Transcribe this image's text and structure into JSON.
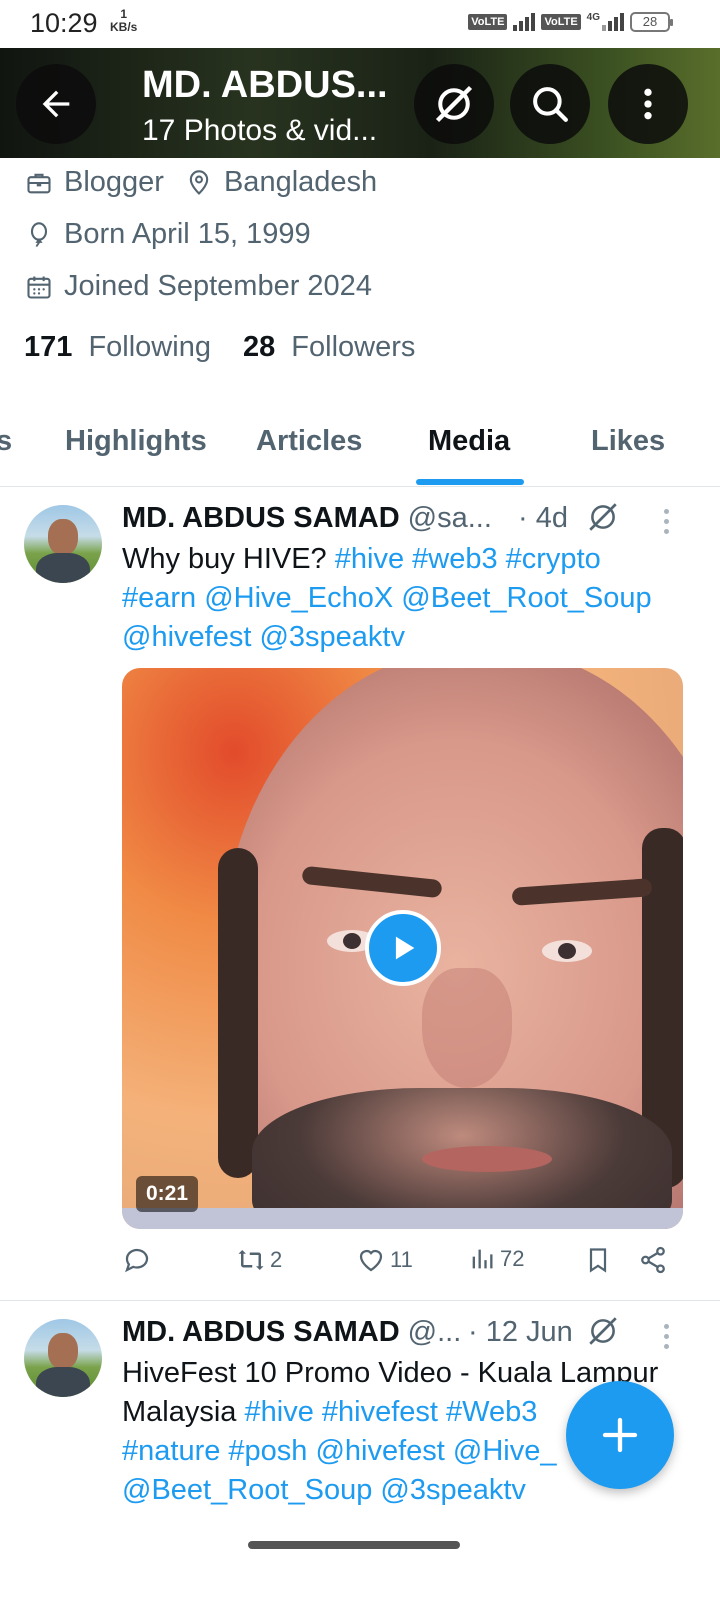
{
  "status_bar": {
    "time": "10:29",
    "net_speed_value": "1",
    "net_speed_unit": "KB/s",
    "volte_1": "VoLTE",
    "volte_2": "VoLTE",
    "network": "4G",
    "battery": "28"
  },
  "header": {
    "title": "MD. ABDUS...",
    "subtitle": "17 Photos & vid..."
  },
  "profile": {
    "category": "Blogger",
    "location": "Bangladesh",
    "born": "Born April 15, 1999",
    "joined": "Joined September 2024",
    "following_count": "171",
    "following_label": "Following",
    "followers_count": "28",
    "followers_label": "Followers"
  },
  "tabs": [
    {
      "label": "s"
    },
    {
      "label": "Highlights"
    },
    {
      "label": "Articles"
    },
    {
      "label": "Media",
      "active": true
    },
    {
      "label": "Likes"
    }
  ],
  "posts": [
    {
      "name": "MD. ABDUS SAMAD",
      "handle": "@sa...",
      "date": "· 4d",
      "text_plain": "Why buy HIVE? ",
      "line1_tags": "#hive #web3 #crypto",
      "line2_tags": "#earn @Hive_EchoX @Beet_Root_Soup",
      "line3_tags": "@hivefest @3speaktv",
      "video_duration": "0:21",
      "retweets": "2",
      "likes": "11",
      "views": "72"
    },
    {
      "name": "MD. ABDUS SAMAD",
      "handle": "@...",
      "date": "· 12 Jun",
      "line1_plain": "HiveFest 10 Promo Video - Kuala Lampur",
      "line2_plain": "Malaysia ",
      "line2_tags": "#hive #hivefest #Web3",
      "line3_tags": "#nature #posh @hivefest @Hive_",
      "line4_tags": "@Beet_Root_Soup @3speaktv"
    }
  ],
  "colors": {
    "accent": "#1d9bf0",
    "text_primary": "#0f1419",
    "text_secondary": "#536471"
  }
}
